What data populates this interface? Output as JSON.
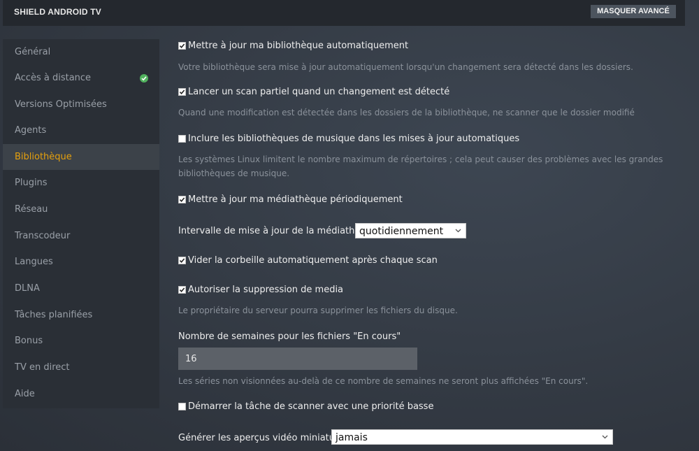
{
  "header": {
    "app_title": "SHIELD ANDROID TV",
    "toggle_advanced_label": "MASQUER AVANCÉ"
  },
  "sidebar": {
    "items": [
      {
        "label": "Général"
      },
      {
        "label": "Accès à distance",
        "status_icon": "check-circle-icon",
        "status_color": "#51b25e"
      },
      {
        "label": "Versions Optimisées"
      },
      {
        "label": "Agents"
      },
      {
        "label": "Bibliothèque",
        "active": true
      },
      {
        "label": "Plugins"
      },
      {
        "label": "Réseau"
      },
      {
        "label": "Transcodeur"
      },
      {
        "label": "Langues"
      },
      {
        "label": "DLNA"
      },
      {
        "label": "Tâches planifiées"
      },
      {
        "label": "Bonus"
      },
      {
        "label": "TV en direct"
      },
      {
        "label": "Aide"
      }
    ]
  },
  "settings": {
    "auto_update": {
      "label": "Mettre à jour ma bibliothèque automatiquement",
      "checked": true,
      "help": "Votre bibliothèque sera mise à jour automatiquement lorsqu'un changement sera détecté dans les dossiers."
    },
    "partial_scan": {
      "label": "Lancer un scan partiel quand un changement est détecté",
      "checked": true,
      "help": "Quand une modification est détectée dans les dossiers de la bibliothèque, ne scanner que le dossier modifié"
    },
    "include_music": {
      "label": "Inclure les bibliothèques de musique dans les mises à jour automatiques",
      "checked": false,
      "help": "Les systèmes Linux limitent le nombre maximum de répertoires ; cela peut causer des problèmes avec les grandes bibliothèques de musique."
    },
    "periodic_update": {
      "label": "Mettre à jour ma médiathèque périodiquement",
      "checked": true
    },
    "update_interval": {
      "label": "Intervalle de mise à jour de la médiathèque",
      "value": "quotidiennement"
    },
    "empty_trash": {
      "label": "Vider la corbeille automatiquement après chaque scan",
      "checked": true
    },
    "allow_delete": {
      "label": "Autoriser la suppression de media",
      "checked": true,
      "help": "Le propriétaire du serveur pourra supprimer les fichiers du disque."
    },
    "on_deck_weeks": {
      "label": "Nombre de semaines pour les fichiers \"En cours\"",
      "value": "16",
      "help": "Les séries non visionnées au-delà de ce nombre de semaines ne seront plus affichées \"En cours\"."
    },
    "low_priority_scan": {
      "label": "Démarrer la tâche de scanner avec une priorité basse",
      "checked": false
    },
    "video_previews": {
      "label": "Générer les aperçus vidéo miniatures",
      "value": "jamais"
    }
  },
  "colors": {
    "accent": "#e5a00d",
    "status_ok": "#51b25e"
  }
}
